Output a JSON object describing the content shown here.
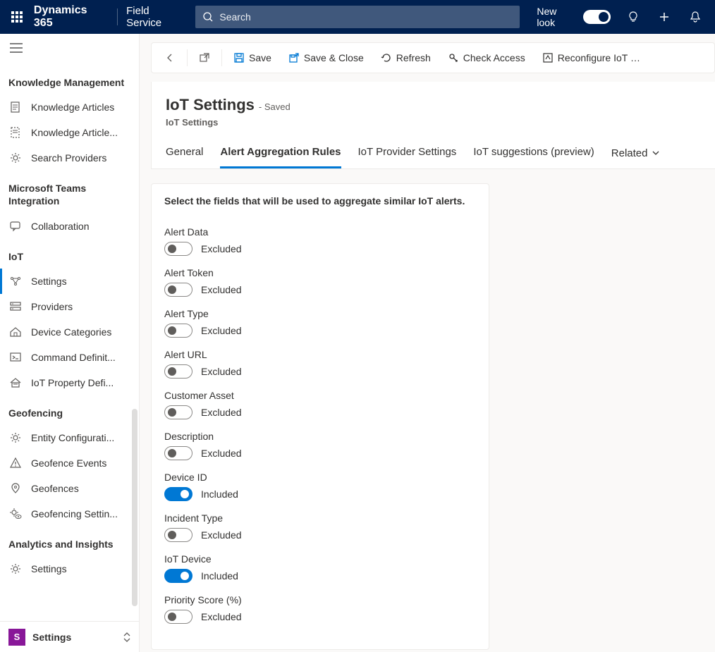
{
  "header": {
    "brand": "Dynamics 365",
    "page": "Field Service",
    "search_placeholder": "Search",
    "new_look_label": "New look"
  },
  "sidebar": {
    "groups": [
      {
        "label": "Knowledge Management",
        "items": [
          {
            "name": "knowledge-articles",
            "label": "Knowledge Articles",
            "icon": "doc"
          },
          {
            "name": "knowledge-article-templates",
            "label": "Knowledge Article...",
            "icon": "doc-dashed"
          },
          {
            "name": "search-providers",
            "label": "Search Providers",
            "icon": "gear"
          }
        ]
      },
      {
        "label": "Microsoft Teams Integration",
        "items": [
          {
            "name": "collaboration",
            "label": "Collaboration",
            "icon": "chat"
          }
        ]
      },
      {
        "label": "IoT",
        "items": [
          {
            "name": "settings",
            "label": "Settings",
            "icon": "iot",
            "selected": true
          },
          {
            "name": "providers",
            "label": "Providers",
            "icon": "providers"
          },
          {
            "name": "device-categories",
            "label": "Device Categories",
            "icon": "devcat"
          },
          {
            "name": "command-definitions",
            "label": "Command Definit...",
            "icon": "cmd"
          },
          {
            "name": "iot-property-definitions",
            "label": "IoT Property Defi...",
            "icon": "prop"
          }
        ]
      },
      {
        "label": "Geofencing",
        "items": [
          {
            "name": "entity-configurations",
            "label": "Entity Configurati...",
            "icon": "gear"
          },
          {
            "name": "geofence-events",
            "label": "Geofence Events",
            "icon": "warning"
          },
          {
            "name": "geofences",
            "label": "Geofences",
            "icon": "pin"
          },
          {
            "name": "geofencing-settings",
            "label": "Geofencing Settin...",
            "icon": "gear-eye"
          }
        ]
      },
      {
        "label": "Analytics and Insights",
        "items": [
          {
            "name": "ai-settings",
            "label": "Settings",
            "icon": "gear"
          }
        ]
      }
    ],
    "footer": {
      "badge": "S",
      "label": "Settings"
    }
  },
  "commands": {
    "back": "Back",
    "popout": "Open in new window",
    "save": "Save",
    "save_close": "Save & Close",
    "refresh": "Refresh",
    "check_access": "Check Access",
    "reconfigure": "Reconfigure IoT sugge..."
  },
  "page": {
    "title": "IoT Settings",
    "saved": "- Saved",
    "entity": "IoT Settings",
    "tabs": [
      "General",
      "Alert Aggregation Rules",
      "IoT Provider Settings",
      "IoT suggestions (preview)",
      "Related"
    ],
    "active_tab_index": 1
  },
  "form": {
    "instruction": "Select the fields that will be used to aggregate similar IoT alerts.",
    "included_label": "Included",
    "excluded_label": "Excluded",
    "fields": [
      {
        "label": "Alert Data",
        "on": false
      },
      {
        "label": "Alert Token",
        "on": false
      },
      {
        "label": "Alert Type",
        "on": false
      },
      {
        "label": "Alert URL",
        "on": false
      },
      {
        "label": "Customer Asset",
        "on": false
      },
      {
        "label": "Description",
        "on": false
      },
      {
        "label": "Device ID",
        "on": true
      },
      {
        "label": "Incident Type",
        "on": false
      },
      {
        "label": "IoT Device",
        "on": true
      },
      {
        "label": "Priority Score (%)",
        "on": false
      }
    ]
  }
}
